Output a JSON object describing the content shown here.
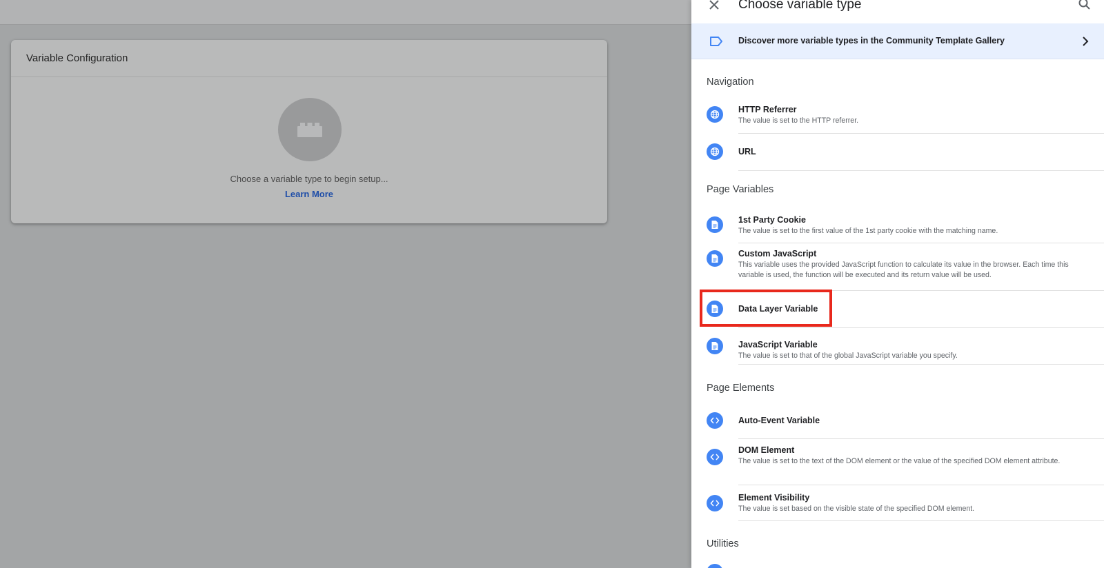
{
  "background": {
    "card_title": "Variable Configuration",
    "hint": "Choose a variable type to begin setup...",
    "learn_more": "Learn More"
  },
  "panel": {
    "title": "Choose variable type",
    "gallery_banner": "Discover more variable types in the Community Template Gallery",
    "sections": {
      "navigation": "Navigation",
      "page_variables": "Page Variables",
      "page_elements": "Page Elements",
      "utilities": "Utilities"
    },
    "items": {
      "http_referrer": {
        "name": "HTTP Referrer",
        "desc": "The value is set to the HTTP referrer.",
        "icon": "globe-icon"
      },
      "url": {
        "name": "URL",
        "icon": "globe-icon"
      },
      "first_party_cookie": {
        "name": "1st Party Cookie",
        "desc": "The value is set to the first value of the 1st party cookie with the matching name.",
        "icon": "document-icon"
      },
      "custom_javascript": {
        "name": "Custom JavaScript",
        "desc": "This variable uses the provided JavaScript function to calculate its value in the browser. Each time this variable is used, the function will be executed and its return value will be used.",
        "icon": "document-icon"
      },
      "data_layer_variable": {
        "name": "Data Layer Variable",
        "icon": "document-icon"
      },
      "javascript_variable": {
        "name": "JavaScript Variable",
        "desc": "The value is set to that of the global JavaScript variable you specify.",
        "icon": "document-icon"
      },
      "auto_event_variable": {
        "name": "Auto-Event Variable",
        "icon": "code-icon"
      },
      "dom_element": {
        "name": "DOM Element",
        "desc": "The value is set to the text of the DOM element or the value of the specified DOM element attribute.",
        "icon": "code-icon"
      },
      "element_visibility": {
        "name": "Element Visibility",
        "desc": "The value is set based on the visible state of the specified DOM element.",
        "icon": "code-icon"
      }
    }
  },
  "colors": {
    "accent": "#4285f4",
    "banner_bg": "#e8f0fe",
    "highlight": "#e8281c",
    "link": "#1f4ea8"
  }
}
